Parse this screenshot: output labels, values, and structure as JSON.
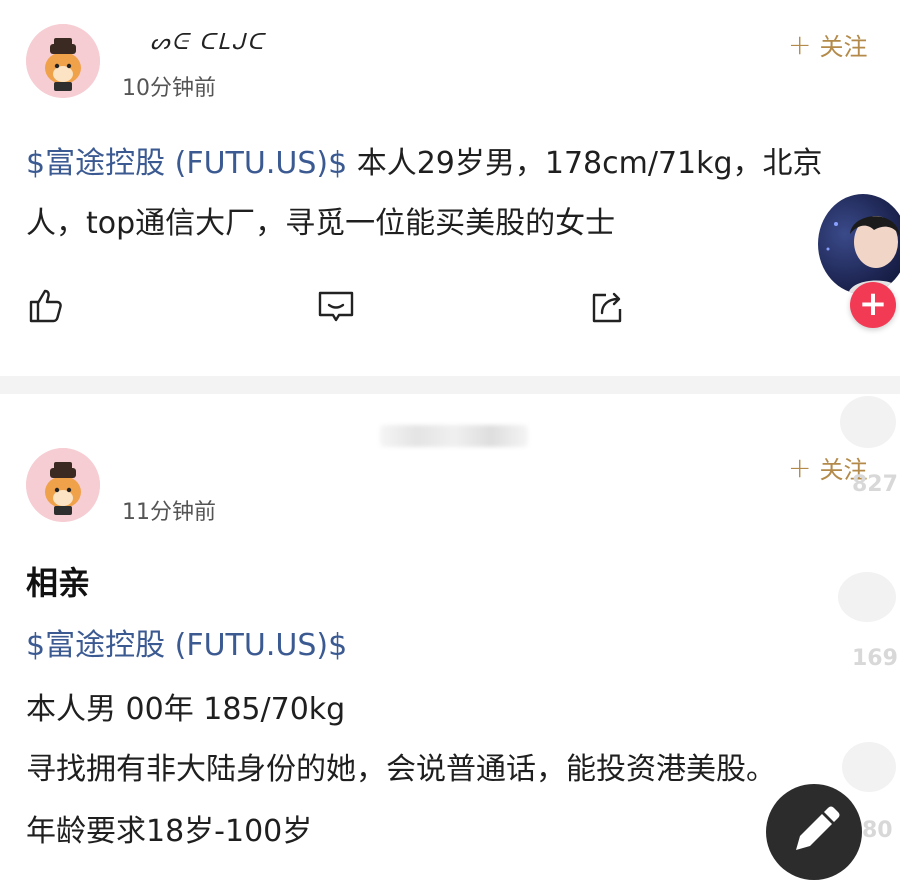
{
  "post1": {
    "username": "ᔕᕮ ᑕᒪᒍᑕ",
    "time": "10分钟前",
    "follow_label": "关注",
    "stock_tag": "$富途控股 (FUTU.US)$",
    "line1_rest": " 本人29岁男，178cm/71kg，北京",
    "line2": "人，top通信大厂，寻觅一位能买美股的女士"
  },
  "post2": {
    "time": "11分钟前",
    "follow_label": "关注",
    "title": "相亲",
    "stock_tag": "$富途控股 (FUTU.US)$",
    "line1": "本人男 00年 185/70kg",
    "line2": "寻找拥有非大陆身份的她，会说普通话，能投资港美股。",
    "line3": "年龄要求18岁-100岁"
  },
  "side": {
    "count1": "827",
    "count2": "169",
    "count3": "80"
  },
  "colors": {
    "stock_tag": "#3c5a92",
    "follow": "#b38a4a",
    "float_plus": "#f23a55",
    "fab": "#2c2c2c"
  }
}
